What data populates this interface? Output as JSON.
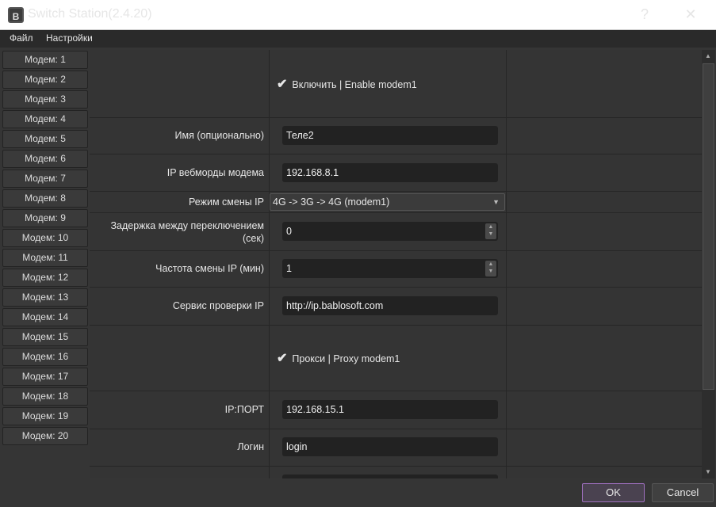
{
  "window": {
    "title": "Switch Station(2.4.20)",
    "icon_label": "B",
    "help": "?",
    "close": "✕"
  },
  "menu": [
    "Файл",
    "Настройки"
  ],
  "sidebar": [
    "Модем: 1",
    "Модем: 2",
    "Модем: 3",
    "Модем: 4",
    "Модем: 5",
    "Модем: 6",
    "Модем: 7",
    "Модем: 8",
    "Модем: 9",
    "Модем: 10",
    "Модем: 11",
    "Модем: 12",
    "Модем: 13",
    "Модем: 14",
    "Модем: 15",
    "Модем: 16",
    "Модем: 17",
    "Модем: 18",
    "Модем: 19",
    "Модем: 20"
  ],
  "form": {
    "enable_label": "Включить | Enable modem1",
    "enable_checked": true,
    "name_label": "Имя (опционально)",
    "name_value": "Теле2",
    "ip_label": "IP вебморды модема",
    "ip_value": "192.168.8.1",
    "mode_label": "Режим смены IP",
    "mode_value": "4G -> 3G -> 4G (modem1)",
    "delay_label": "Задержка между переключением (сек)",
    "delay_value": "0",
    "freq_label": "Частота смены IP (мин)",
    "freq_value": "1",
    "service_label": "Сервис проверки IP",
    "service_value": "http://ip.bablosoft.com",
    "proxy_label": "Прокси | Proxy modem1",
    "proxy_checked": true,
    "ipport_label": "IP:ПОРТ",
    "ipport_value": "192.168.15.1",
    "login_label": "Логин",
    "login_value": "login"
  },
  "buttons": {
    "ok": "OK",
    "cancel": "Cancel"
  },
  "check_glyph": "✔"
}
